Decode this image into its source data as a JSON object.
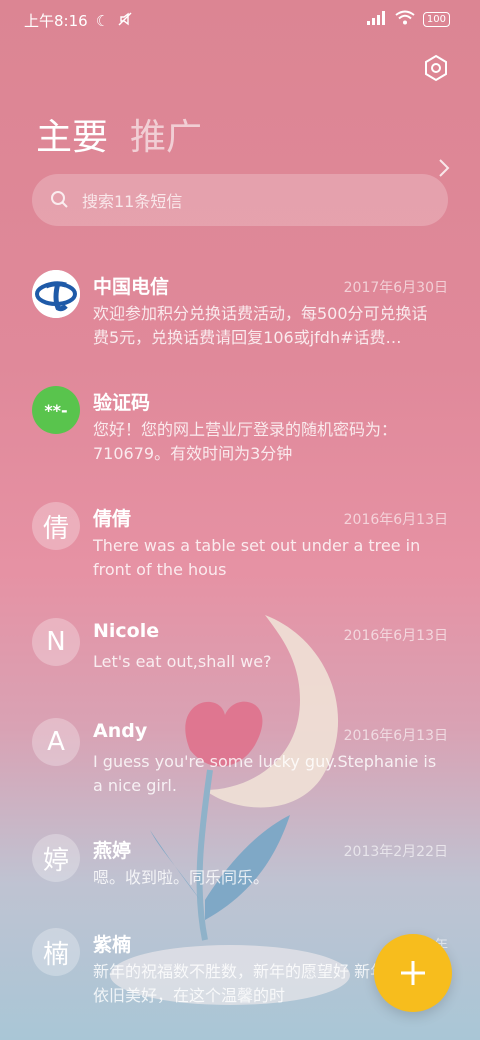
{
  "status_bar": {
    "time": "上午8:16",
    "battery": "100"
  },
  "tabs": {
    "main": "主要",
    "promo": "推广"
  },
  "search": {
    "placeholder": "搜索11条短信"
  },
  "conversations": [
    {
      "avatar": "",
      "name": "中国电信",
      "date": "2017年6月30日",
      "preview": "欢迎参加积分兑换话费活动，每500分可兑换话费5元，兑换话费请回复106或jfdh#话费…"
    },
    {
      "avatar": "**-",
      "name": "验证码",
      "date": "",
      "preview": "您好！您的网上营业厅登录的随机密码为：710679。有效时间为3分钟"
    },
    {
      "avatar": "倩",
      "name": "倩倩",
      "date": "2016年6月13日",
      "preview": "There was a table set out under a tree in front of the hous"
    },
    {
      "avatar": "N",
      "name": "Nicole",
      "date": "2016年6月13日",
      "preview": "Let's eat out,shall we?"
    },
    {
      "avatar": "A",
      "name": "Andy",
      "date": "2016年6月13日",
      "preview": "I guess you're some lucky guy.Stephanie is a nice girl."
    },
    {
      "avatar": "婷",
      "name": "燕婷",
      "date": "2013年2月22日",
      "preview": "嗯。收到啦。同乐同乐。"
    },
    {
      "avatar": "楠",
      "name": "紫楠",
      "date": "2013年",
      "preview": "新年的祝福数不胜数，新年的愿望好 新年的问候依旧美好，在这个温馨的时"
    }
  ],
  "colors": {
    "fab": "#f7bd1d",
    "telecom_blue": "#1e5aa8",
    "verify_green": "#59c44d"
  }
}
